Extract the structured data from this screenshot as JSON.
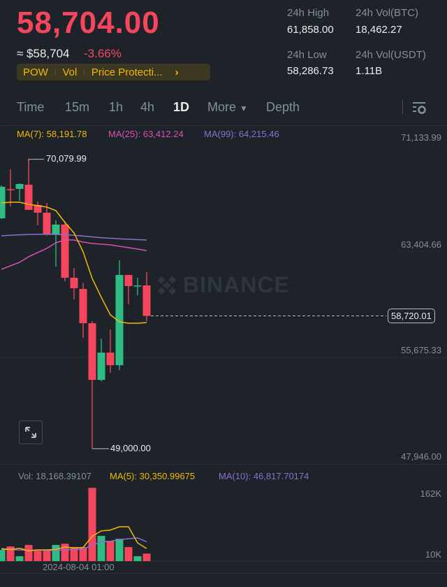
{
  "header": {
    "last_price": "58,704.00",
    "approx_usd": "≈ $58,704",
    "change_pct": "-3.66%",
    "tags": [
      "POW",
      "Vol",
      "Price Protecti..."
    ],
    "stats": {
      "high_label": "24h High",
      "high": "61,858.00",
      "vol_btc_label": "24h Vol(BTC)",
      "vol_btc": "18,462.27",
      "low_label": "24h Low",
      "low": "58,286.73",
      "vol_usdt_label": "24h Vol(USDT)",
      "vol_usdt": "1.11B"
    }
  },
  "tabs": [
    {
      "label": "Time"
    },
    {
      "label": "15m"
    },
    {
      "label": "1h"
    },
    {
      "label": "4h"
    },
    {
      "label": "1D",
      "active": true
    },
    {
      "label": "More"
    },
    {
      "label": "Depth"
    }
  ],
  "legend": {
    "ma7": "MA(7): 58,191.78",
    "ma25": "MA(25): 63,412.24",
    "ma99": "MA(99): 64,215.46"
  },
  "watermark": "BINANCE",
  "colors": {
    "up": "#2ebd85",
    "down": "#f6465d",
    "ma7": "#f0b90b",
    "ma25": "#d94fb6",
    "ma99": "#8c6fd1",
    "accent": "#f0b90b"
  },
  "chart_data": {
    "type": "candlestick",
    "price_axis_ticks": [
      "71,133.99",
      "63,404.66",
      "55,675.33",
      "47,946.00"
    ],
    "price_range": [
      47946.0,
      71133.99
    ],
    "current_price": "58,720.01",
    "high_marker": "70,079.99",
    "low_marker": "49,000.00",
    "x_label": "2024-08-04 01:00",
    "candles": [
      {
        "o": 65862,
        "h": 68268,
        "l": 65811,
        "c": 68166,
        "v": 27000
      },
      {
        "o": 67990,
        "h": 69445,
        "l": 66733,
        "c": 67950,
        "v": 35500
      },
      {
        "o": 68012,
        "h": 68421,
        "l": 67142,
        "c": 68370,
        "v": 11800
      },
      {
        "o": 68319,
        "h": 70079.99,
        "l": 66528,
        "c": 66477,
        "v": 39000
      },
      {
        "o": 66835,
        "h": 67091,
        "l": 65351,
        "c": 66272,
        "v": 25000
      },
      {
        "o": 66272,
        "h": 66988,
        "l": 64600,
        "c": 64685,
        "v": 25000
      },
      {
        "o": 64685,
        "h": 65709,
        "l": 62331,
        "c": 65402,
        "v": 39000
      },
      {
        "o": 65402,
        "h": 65658,
        "l": 61256,
        "c": 61512,
        "v": 42000
      },
      {
        "o": 61512,
        "h": 62229,
        "l": 59926,
        "c": 60745,
        "v": 34000
      },
      {
        "o": 60693,
        "h": 61154,
        "l": 57111,
        "c": 58186,
        "v": 34000
      },
      {
        "o": 58186,
        "h": 58339,
        "l": 49000,
        "c": 54040,
        "v": 177000
      },
      {
        "o": 54040,
        "h": 57060,
        "l": 53938,
        "c": 56036,
        "v": 61000
      },
      {
        "o": 56036,
        "h": 57725,
        "l": 54552,
        "c": 55114,
        "v": 49000
      },
      {
        "o": 55114,
        "h": 62792,
        "l": 54756,
        "c": 61717,
        "v": 54000
      },
      {
        "o": 61717,
        "h": 61717,
        "l": 59567,
        "c": 60898,
        "v": 34000
      },
      {
        "o": 60898,
        "h": 61512,
        "l": 60233,
        "c": 60950,
        "v": 11800
      },
      {
        "o": 60950,
        "h": 61922,
        "l": 58339,
        "c": 58720.01,
        "v": 18168.39
      }
    ],
    "ma7": [
      66988,
      67040,
      67040,
      66886,
      66784,
      66681,
      66425,
      65555,
      64788,
      63406,
      61461,
      60080,
      58800,
      58288,
      58186,
      58186,
      58237
    ],
    "ma25": [
      62126,
      62382,
      62638,
      63048,
      63355,
      63662,
      64071,
      64276,
      64276,
      64122,
      64020,
      63969,
      63918,
      63815,
      63713,
      63611,
      63508
    ],
    "ma99": [
      64583,
      64620,
      64650,
      64680,
      64690,
      64690,
      64685,
      64660,
      64620,
      64560,
      64500,
      64440,
      64400,
      64360,
      64330,
      64300,
      64276
    ],
    "volume_axis_ticks": [
      "162K",
      "10K"
    ],
    "volume_legend": {
      "vol": "Vol: 18,168.39107",
      "ma5": "MA(5): 30,350.99675",
      "ma10": "MA(10): 46,817.70174"
    },
    "vol_ma5": [
      30000,
      28000,
      31000,
      25000,
      27000,
      27000,
      28000,
      34000,
      32000,
      33000,
      60000,
      73000,
      75000,
      83000,
      83000,
      44000,
      30351
    ],
    "vol_ma10": [
      28000,
      28000,
      27000,
      26000,
      27000,
      26000,
      26000,
      27000,
      28000,
      29000,
      38000,
      47000,
      48000,
      52000,
      54000,
      56000,
      46818
    ]
  }
}
